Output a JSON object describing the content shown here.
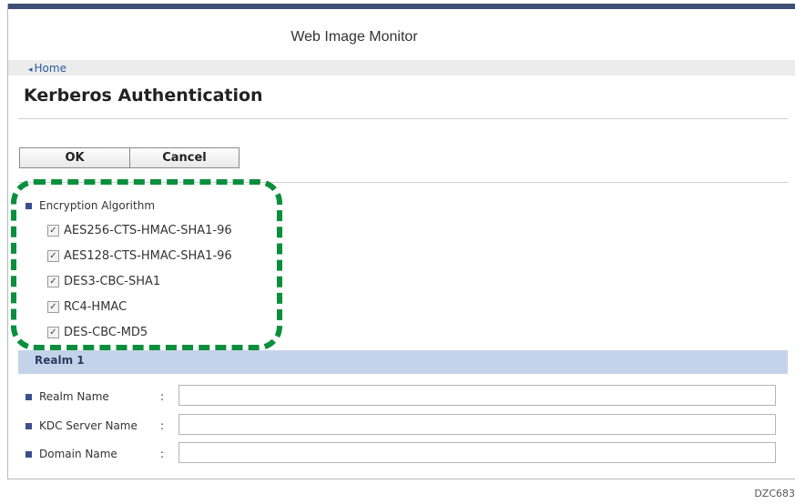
{
  "header": {
    "app_title": "Web Image Monitor"
  },
  "nav": {
    "home_label": "Home"
  },
  "page": {
    "title": "Kerberos Authentication"
  },
  "buttons": {
    "ok_label": "OK",
    "cancel_label": "Cancel"
  },
  "encryption": {
    "heading": "Encryption Algorithm",
    "options": [
      {
        "label": "AES256-CTS-HMAC-SHA1-96",
        "checked": true
      },
      {
        "label": "AES128-CTS-HMAC-SHA1-96",
        "checked": true
      },
      {
        "label": "DES3-CBC-SHA1",
        "checked": true
      },
      {
        "label": "RC4-HMAC",
        "checked": true
      },
      {
        "label": "DES-CBC-MD5",
        "checked": true
      }
    ]
  },
  "realm": {
    "section_title": "Realm 1",
    "fields": [
      {
        "label": "Realm Name",
        "value": ""
      },
      {
        "label": "KDC Server Name",
        "value": ""
      },
      {
        "label": "Domain Name",
        "value": ""
      }
    ]
  },
  "colors": {
    "topbar": "#3d4f75",
    "highlight": "#0a8f3c",
    "realm_bar": "#c5d3ea",
    "bullet": "#3a4f8c"
  },
  "footer": {
    "ref_code": "DZC683"
  }
}
